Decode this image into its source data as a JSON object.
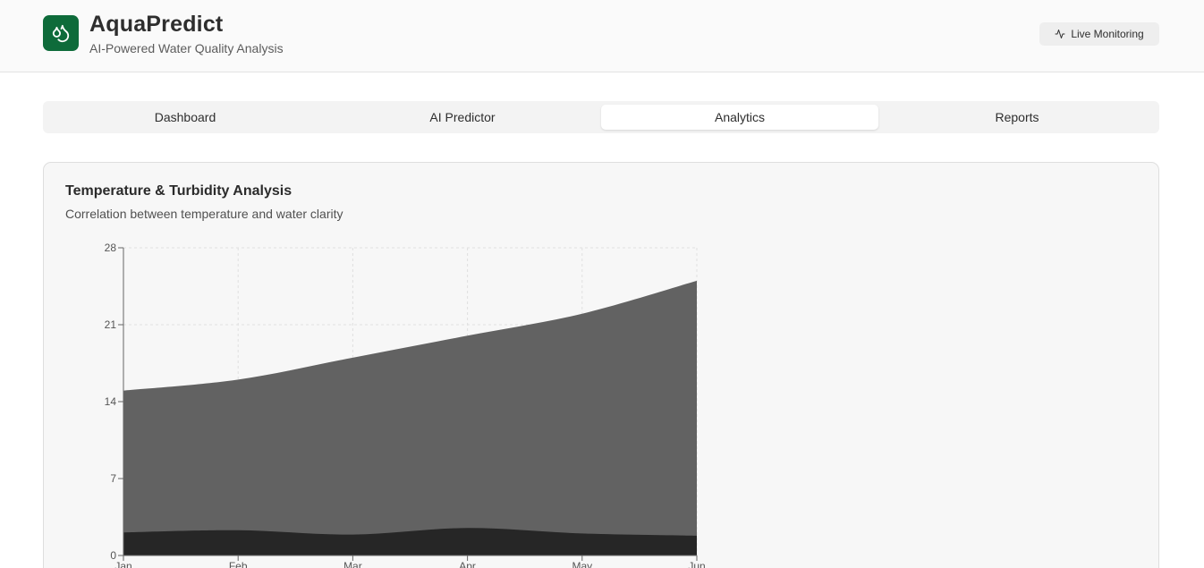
{
  "header": {
    "title": "AquaPredict",
    "subtitle": "AI-Powered Water Quality Analysis",
    "live_label": "Live Monitoring",
    "logo_icon": "droplets-icon",
    "live_icon": "activity-icon",
    "brand_color": "#0e6b3a"
  },
  "tabs": [
    {
      "label": "Dashboard",
      "active": false
    },
    {
      "label": "AI Predictor",
      "active": false
    },
    {
      "label": "Analytics",
      "active": true
    },
    {
      "label": "Reports",
      "active": false
    }
  ],
  "card": {
    "title": "Temperature & Turbidity Analysis",
    "description": "Correlation between temperature and water clarity"
  },
  "chart_data": {
    "type": "area",
    "stacked": false,
    "categories": [
      "Jan",
      "Feb",
      "Mar",
      "Apr",
      "May",
      "Jun"
    ],
    "series": [
      {
        "values": [
          15,
          16,
          18,
          20,
          22,
          25
        ],
        "color": "#626262"
      },
      {
        "values": [
          2.1,
          2.3,
          1.9,
          2.5,
          2.0,
          1.8
        ],
        "color": "#262626"
      }
    ],
    "yticks": [
      0,
      7,
      14,
      21,
      28
    ],
    "ylim": [
      0,
      28
    ],
    "grid": true
  }
}
